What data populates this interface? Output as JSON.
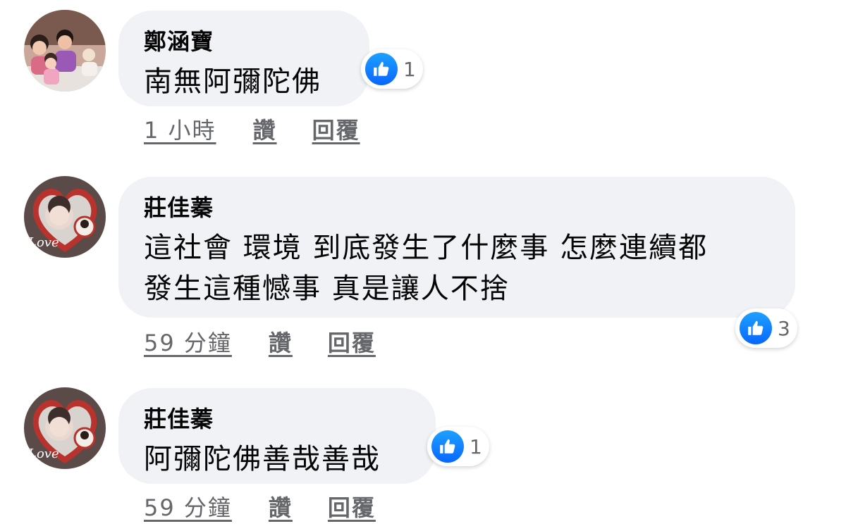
{
  "comments": [
    {
      "author": "鄭涵寶",
      "text": "南無阿彌陀佛",
      "reaction_count": "1",
      "time": "1 小時",
      "like_label": "讚",
      "reply_label": "回覆"
    },
    {
      "author": "莊佳蓁",
      "text_line1": "這社會 環境 到底發生了什麼事 怎麼連續都",
      "text_line2": "發生這種憾事 真是讓人不捨",
      "reaction_count": "3",
      "time": "59 分鐘",
      "like_label": "讚",
      "reply_label": "回覆"
    },
    {
      "author": "莊佳蓁",
      "text": "阿彌陀佛善哉善哉",
      "reaction_count": "1",
      "time": "59 分鐘",
      "like_label": "讚",
      "reply_label": "回覆"
    }
  ],
  "colors": {
    "bubble": "#f0f2f5",
    "secondary_text": "#65676b",
    "like_blue": "#0866ff"
  },
  "icons": {
    "reaction": "thumbs-up-icon"
  }
}
